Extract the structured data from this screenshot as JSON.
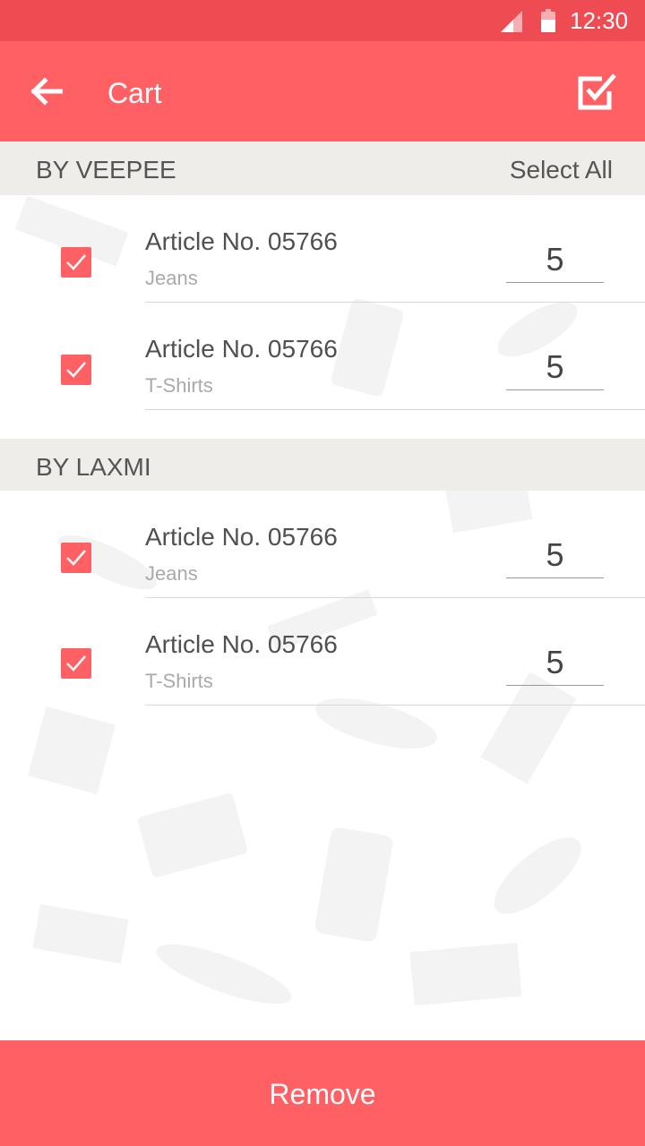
{
  "status_bar": {
    "time": "12:30",
    "signal_icon": "signal-icon",
    "battery_icon": "battery-icon"
  },
  "app_bar": {
    "title": "Cart",
    "back_icon": "arrow-left-icon",
    "action_icon": "checkbox-checked-icon"
  },
  "sections": [
    {
      "title": "BY VEEPEE",
      "action": "Select All",
      "items": [
        {
          "name": "Article No. 05766",
          "category": "Jeans",
          "quantity": "5",
          "checked": true
        },
        {
          "name": "Article No. 05766",
          "category": "T-Shirts",
          "quantity": "5",
          "checked": true
        }
      ]
    },
    {
      "title": "BY LAXMI",
      "items": [
        {
          "name": "Article No. 05766",
          "category": "Jeans",
          "quantity": "5",
          "checked": true
        },
        {
          "name": "Article No. 05766",
          "category": "T-Shirts",
          "quantity": "5",
          "checked": true
        }
      ]
    }
  ],
  "footer": {
    "remove_label": "Remove"
  },
  "colors": {
    "status_bar": "#ee4b53",
    "accent": "#ff6064",
    "section_bg": "#efedea"
  }
}
